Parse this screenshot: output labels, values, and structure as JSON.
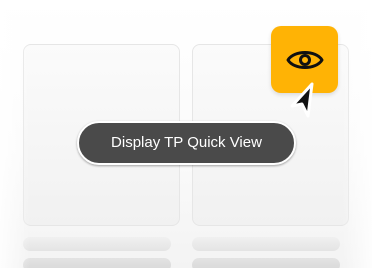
{
  "tooltip": {
    "text": "Display TP Quick View"
  },
  "eye_button": {
    "icon": "eye-icon",
    "color": "#ffb305"
  },
  "cursor": {
    "icon": "mouse-pointer-icon"
  },
  "colors": {
    "tooltip_bg": "#4a4a4a",
    "accent": "#ffb305"
  }
}
